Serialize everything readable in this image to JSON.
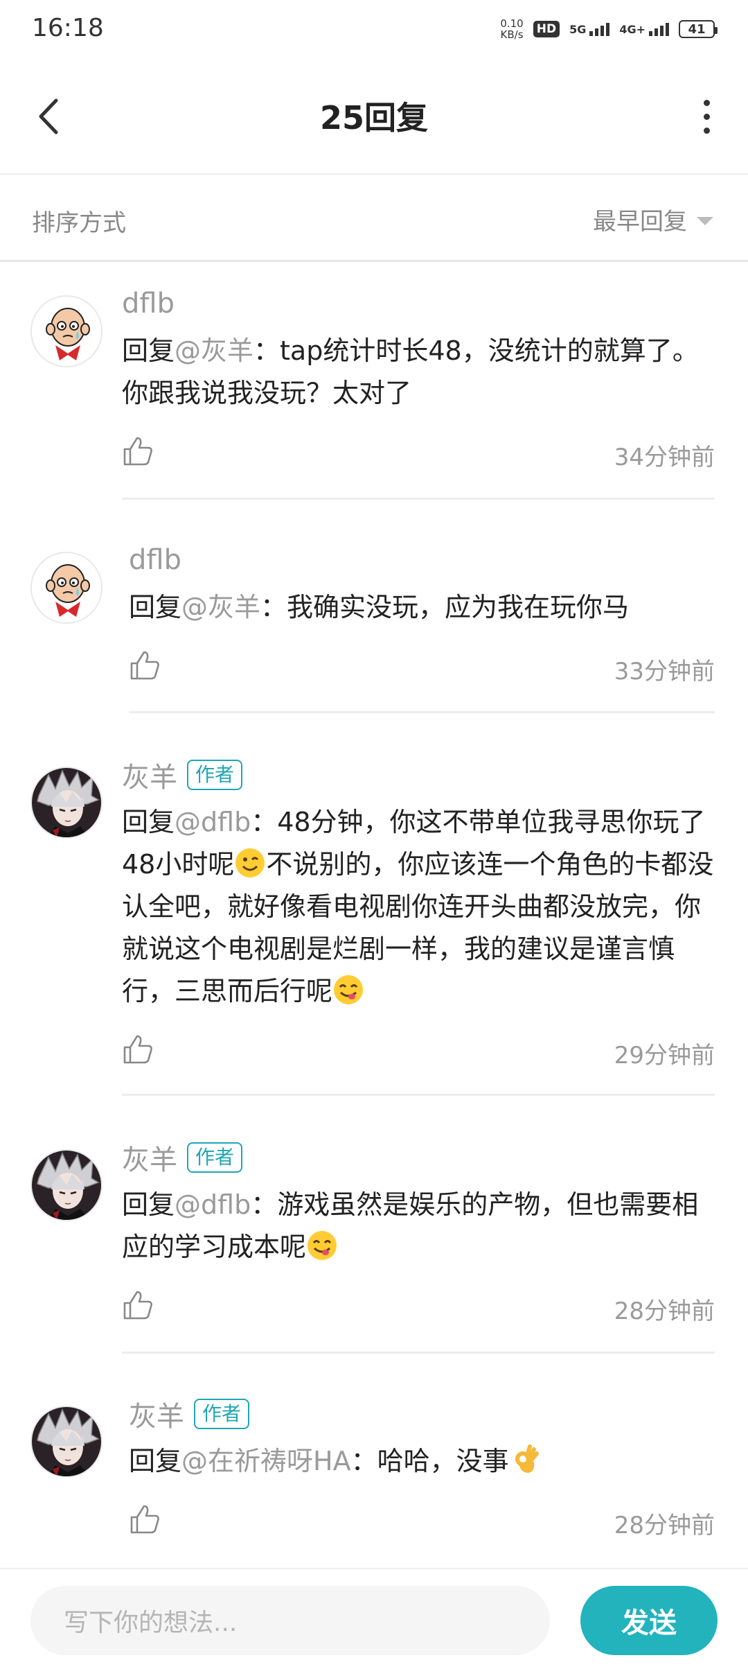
{
  "status_bar": {
    "time": "16:18",
    "net_speed_value": "0.10",
    "net_speed_unit": "KB/s",
    "hd_label": "HD",
    "sim1_label": "5G",
    "sim2_label": "4G+",
    "battery": "41"
  },
  "header": {
    "title": "25回复"
  },
  "sort": {
    "label": "排序方式",
    "selected": "最早回复"
  },
  "comments": [
    {
      "username": "dflb",
      "author_badge": "",
      "reply_prefix": "回复",
      "mention": "@灰羊",
      "text": "：tap统计时长48，没统计的就算了。你跟我说我没玩？太对了",
      "time": "34分钟前"
    },
    {
      "username": "dflb",
      "author_badge": "",
      "reply_prefix": "回复",
      "mention": "@灰羊",
      "text": "：我确实没玩，应为我在玩你马",
      "time": "33分钟前"
    },
    {
      "username": "灰羊",
      "author_badge": "作者",
      "reply_prefix": "回复",
      "mention": "@dflb",
      "text_part1": "：48分钟，你这不带单位我寻思你玩了48小时呢",
      "text_part2": "不说别的，你应该连一个角色的卡都没认全吧，就好像看电视剧你连开头曲都没放完，你就说这个电视剧是烂剧一样，我的建议是谨言慎行，三思而后行呢",
      "emoji1": "wink-emoji",
      "emoji2": "yum-emoji",
      "time": "29分钟前"
    },
    {
      "username": "灰羊",
      "author_badge": "作者",
      "reply_prefix": "回复",
      "mention": "@dflb",
      "text": "：游戏虽然是娱乐的产物，但也需要相应的学习成本呢",
      "emoji": "yum-emoji",
      "time": "28分钟前"
    },
    {
      "username": "灰羊",
      "author_badge": "作者",
      "reply_prefix": "回复",
      "mention": "@在祈祷呀HA",
      "text": "：哈哈，没事",
      "emoji": "ok-hand-emoji",
      "time": "28分钟前"
    }
  ],
  "input": {
    "placeholder": "写下你的想法..."
  },
  "send_button": {
    "label": "发送"
  },
  "colors": {
    "accent": "#23b3bd",
    "badge": "#1fa6b3",
    "muted_text": "#9a9a9a"
  }
}
